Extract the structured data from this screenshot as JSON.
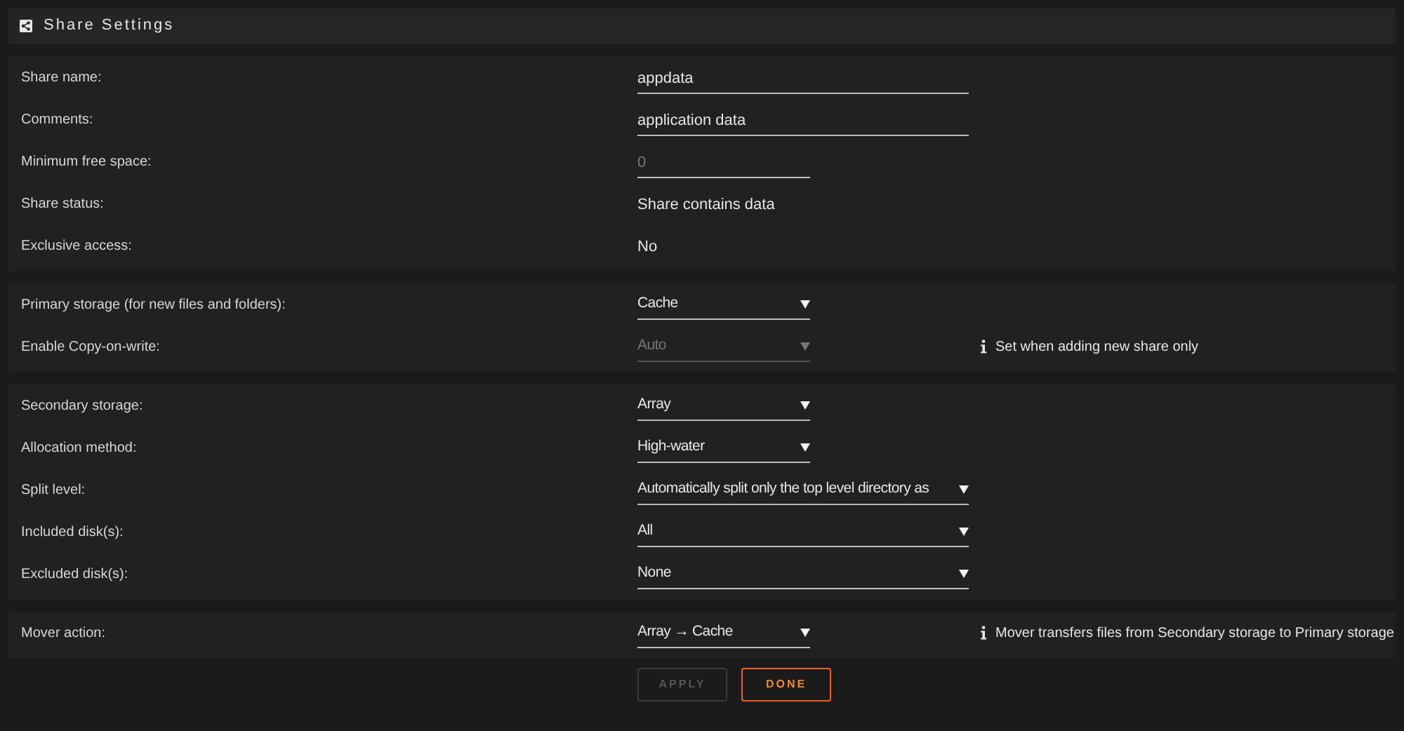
{
  "header": {
    "title": "Share Settings"
  },
  "sections": [
    {
      "rows": [
        {
          "label": "Share name:",
          "kind": "input",
          "value": "appdata",
          "wide": true
        },
        {
          "label": "Comments:",
          "kind": "input",
          "value": "application data",
          "wide": true
        },
        {
          "label": "Minimum free space:",
          "kind": "input",
          "placeholder": "0",
          "wide": false
        },
        {
          "label": "Share status:",
          "kind": "text",
          "value": "Share contains data"
        },
        {
          "label": "Exclusive access:",
          "kind": "text",
          "value": "No"
        }
      ]
    },
    {
      "rows": [
        {
          "label": "Primary storage (for new files and folders):",
          "kind": "select",
          "value": "Cache",
          "wide": false,
          "disabled": false
        },
        {
          "label": "Enable Copy-on-write:",
          "kind": "select",
          "value": "Auto",
          "wide": false,
          "disabled": true,
          "note": "Set when adding new share only"
        }
      ]
    },
    {
      "rows": [
        {
          "label": "Secondary storage:",
          "kind": "select",
          "value": "Array",
          "wide": false,
          "disabled": false
        },
        {
          "label": "Allocation method:",
          "kind": "select",
          "value": "High-water",
          "wide": false,
          "disabled": false
        },
        {
          "label": "Split level:",
          "kind": "select",
          "value": "Automatically split only the top level directory as",
          "wide": true,
          "disabled": false
        },
        {
          "label": "Included disk(s):",
          "kind": "select",
          "value": "All",
          "wide": true,
          "disabled": false
        },
        {
          "label": "Excluded disk(s):",
          "kind": "select",
          "value": "None",
          "wide": true,
          "disabled": false
        }
      ]
    },
    {
      "rows": [
        {
          "label": "Mover action:",
          "kind": "select",
          "value": "Array → Cache",
          "wide": false,
          "disabled": false,
          "note": "Mover transfers files from Secondary storage to Primary storage"
        }
      ]
    }
  ],
  "buttons": [
    {
      "label": "APPLY",
      "disabled": true
    },
    {
      "label": "DONE",
      "disabled": false
    }
  ]
}
